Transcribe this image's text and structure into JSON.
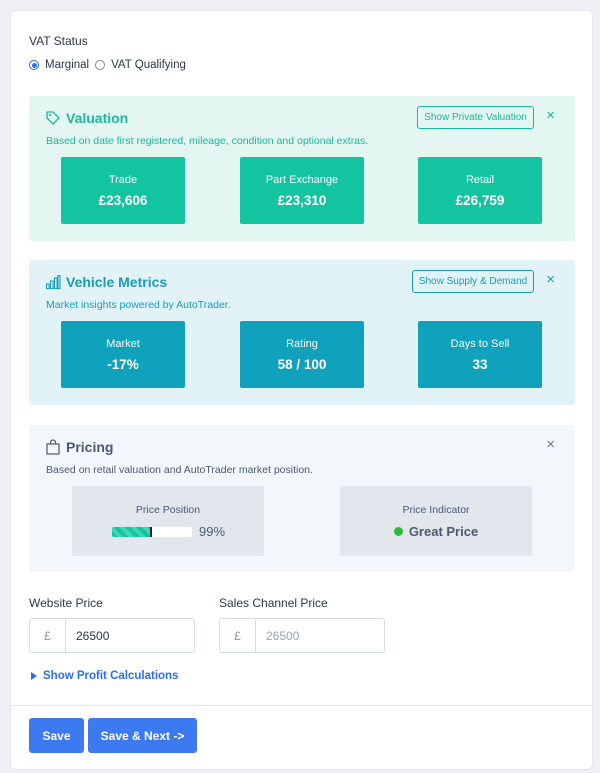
{
  "vat": {
    "label": "VAT Status",
    "options": [
      {
        "label": "Marginal",
        "selected": true
      },
      {
        "label": "VAT Qualifying",
        "selected": false
      }
    ]
  },
  "valuation": {
    "title": "Valuation",
    "subtitle": "Based on date first registered, mileage, condition and optional extras.",
    "button": "Show Private Valuation",
    "close": "×",
    "icon": "tag-icon",
    "color": "#12c4a0",
    "tiles": [
      {
        "label": "Trade",
        "value": "£23,606"
      },
      {
        "label": "Part Exchange",
        "value": "£23,310"
      },
      {
        "label": "Retail",
        "value": "£26,759"
      }
    ]
  },
  "metrics": {
    "title": "Vehicle Metrics",
    "subtitle": "Market insights powered by AutoTrader.",
    "button": "Show Supply & Demand",
    "close": "×",
    "icon": "signal-bars-icon",
    "color": "#10a1bd",
    "tiles": [
      {
        "label": "Market",
        "value": "-17%"
      },
      {
        "label": "Rating",
        "value": "58 / 100"
      },
      {
        "label": "Days to Sell",
        "value": "33"
      }
    ]
  },
  "pricing": {
    "title": "Pricing",
    "subtitle": "Based on retail valuation and AutoTrader market position.",
    "close": "×",
    "icon": "shopping-bag-icon",
    "position_label": "Price Position",
    "position_fill": 0.5,
    "position_pct": "99%",
    "indicator_label": "Price Indicator",
    "indicator_value": "Great Price",
    "indicator_color": "#2bbd3a"
  },
  "website_price": {
    "label": "Website Price",
    "currency": "£",
    "value": "26500"
  },
  "sales_channel_price": {
    "label": "Sales Channel Price",
    "currency": "£",
    "placeholder": "26500"
  },
  "profit_link": "Show Profit Calculations",
  "buttons": {
    "save": "Save",
    "save_next": "Save & Next ->"
  },
  "accent": "#3d7af2"
}
